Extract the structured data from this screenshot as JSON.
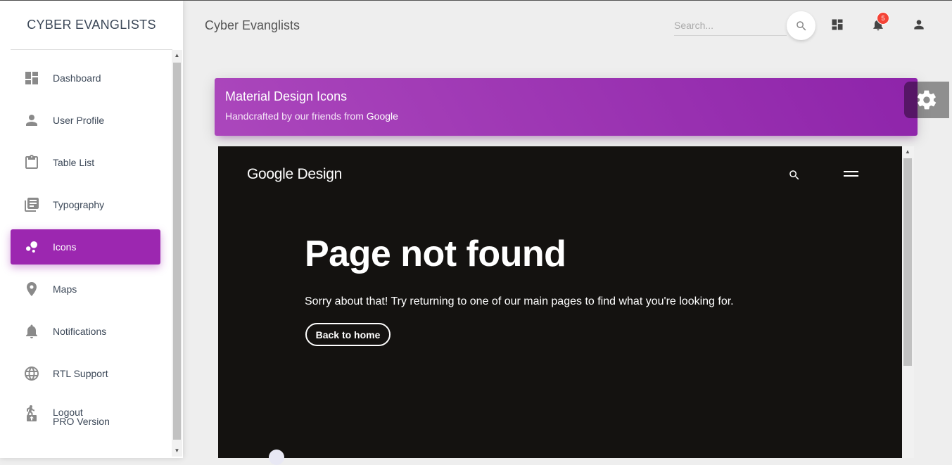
{
  "sidebar": {
    "brand": "CYBER EVANGLISTS",
    "items": [
      {
        "label": "Dashboard",
        "icon": "dashboard-icon"
      },
      {
        "label": "User Profile",
        "icon": "person-icon"
      },
      {
        "label": "Table List",
        "icon": "clipboard-icon"
      },
      {
        "label": "Typography",
        "icon": "library-books-icon"
      },
      {
        "label": "Icons",
        "icon": "bubble-chart-icon",
        "active": true
      },
      {
        "label": "Maps",
        "icon": "location-pin-icon"
      },
      {
        "label": "Notifications",
        "icon": "bell-icon"
      },
      {
        "label": "RTL Support",
        "icon": "globe-icon"
      }
    ],
    "logout_label": "Logout",
    "pro_label": "PRO Version"
  },
  "navbar": {
    "title": "Cyber Evanglists",
    "search_placeholder": "Search...",
    "notification_count": "5"
  },
  "card": {
    "title": "Material Design Icons",
    "subtitle_prefix": "Handcrafted by our friends from ",
    "subtitle_link": "Google"
  },
  "iframe": {
    "logo_google": "Google",
    "logo_design": "Design",
    "heading": "Page not found",
    "message": "Sorry about that! Try returning to one of our main pages to find what you're looking for.",
    "button_label": "Back to home"
  },
  "colors": {
    "accent": "#9c27b0",
    "badge": "#f44336",
    "iframe_bg": "#141210"
  }
}
